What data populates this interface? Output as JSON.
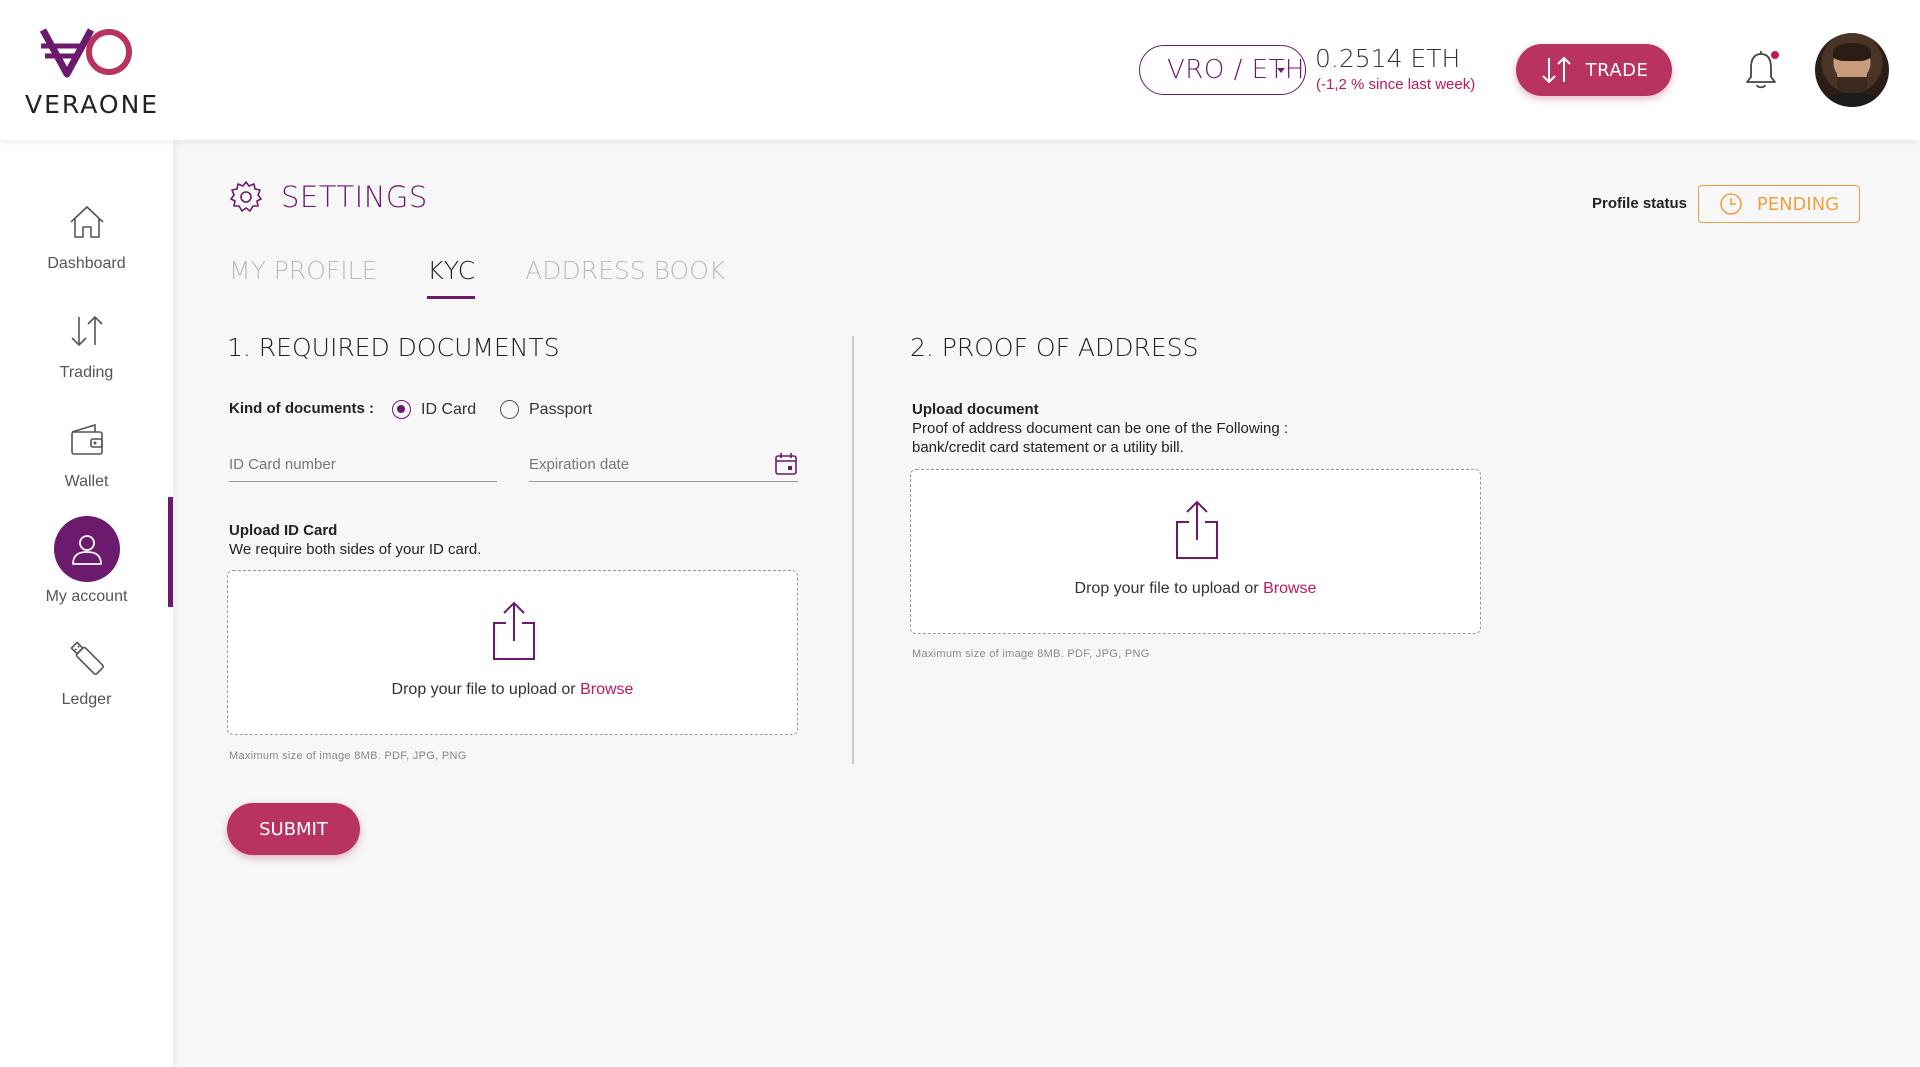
{
  "brand": {
    "name": "VERAONE",
    "accent": "#6b1a6e",
    "primary_button": "#b8335f"
  },
  "header": {
    "pair": "VRO / ETH",
    "price": "0.2514 ETH",
    "price_change": "(-1,2 % since last week)",
    "trade_label": "TRADE"
  },
  "sidebar": {
    "items": [
      {
        "label": "Dashboard",
        "icon": "home-icon"
      },
      {
        "label": "Trading",
        "icon": "arrows-updown-icon"
      },
      {
        "label": "Wallet",
        "icon": "wallet-icon"
      },
      {
        "label": "My account",
        "icon": "user-icon",
        "active": true
      },
      {
        "label": "Ledger",
        "icon": "usb-key-icon"
      }
    ]
  },
  "page": {
    "title": "SETTINGS",
    "profile_status_label": "Profile status",
    "profile_status_value": "PENDING",
    "tabs": [
      {
        "label": "MY PROFILE"
      },
      {
        "label": "KYC",
        "active": true
      },
      {
        "label": "ADDRESS BOOK"
      }
    ]
  },
  "required_docs": {
    "title": "1. REQUIRED DOCUMENTS",
    "kind_label": "Kind of documents :",
    "options": [
      {
        "label": "ID Card",
        "checked": true
      },
      {
        "label": "Passport",
        "checked": false
      }
    ],
    "id_number_placeholder": "ID Card number",
    "expiration_placeholder": "Expiration date",
    "upload_title": "Upload ID Card",
    "upload_desc": "We require both sides of your ID card.",
    "drop_text": "Drop your file to upload or",
    "browse": "Browse",
    "max_note": "Maximum size of image 8MB. PDF, JPG, PNG"
  },
  "proof_address": {
    "title": "2. PROOF OF ADDRESS",
    "upload_title": "Upload document",
    "upload_desc_1": "Proof of address document can be one of the Following :",
    "upload_desc_2": "bank/credit card statement or a utility bill.",
    "drop_text": "Drop your file to upload or",
    "browse": "Browse",
    "max_note": "Maximum size of image 8MB. PDF, JPG, PNG"
  },
  "submit_label": "SUBMIT"
}
